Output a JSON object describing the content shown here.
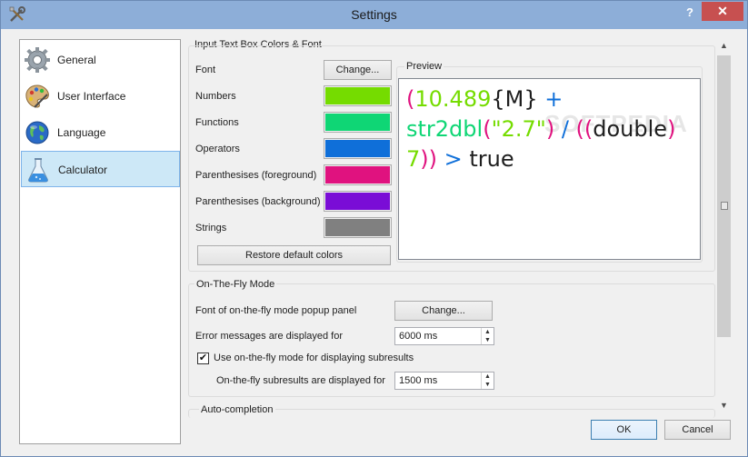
{
  "window": {
    "title": "Settings",
    "help": "?",
    "close": "✕"
  },
  "nav": {
    "items": [
      {
        "label": "General",
        "icon": "gear-icon"
      },
      {
        "label": "User Interface",
        "icon": "palette-icon"
      },
      {
        "label": "Language",
        "icon": "globe-icon"
      },
      {
        "label": "Calculator",
        "icon": "flask-icon",
        "selected": true
      }
    ]
  },
  "input_colors": {
    "title": "Input Text Box Colors & Font",
    "font_label": "Font",
    "font_button": "Change...",
    "rows": [
      {
        "label": "Numbers",
        "color": "#75dc00"
      },
      {
        "label": "Functions",
        "color": "#0fd675"
      },
      {
        "label": "Operators",
        "color": "#0f6fd9"
      },
      {
        "label": "Parenthesises (foreground)",
        "color": "#e0127f"
      },
      {
        "label": "Parenthesises (background)",
        "color": "#7a0dd6"
      },
      {
        "label": "Strings",
        "color": "#808080"
      }
    ],
    "restore_button": "Restore default colors",
    "preview_title": "Preview",
    "watermark": "SOFTPEDIA",
    "preview_tokens": [
      {
        "t": "(",
        "c": "#e0127f"
      },
      {
        "t": "10.489",
        "c": "#75dc00"
      },
      {
        "t": "{M}",
        "c": "#1e1e1e"
      },
      {
        "t": " + ",
        "c": "#0f6fd9"
      },
      {
        "t": "str2dbl",
        "c": "#0fd675"
      },
      {
        "t": "(",
        "c": "#e0127f"
      },
      {
        "t": "\"2.7\"",
        "c": "#75dc00"
      },
      {
        "t": ")",
        "c": "#e0127f"
      },
      {
        "t": " / ",
        "c": "#0f6fd9"
      },
      {
        "t": "((",
        "c": "#e0127f"
      },
      {
        "t": "double",
        "c": "#1e1e1e"
      },
      {
        "t": " 7",
        "c": "#75dc00"
      },
      {
        "t": "))",
        "c": "#e0127f"
      },
      {
        "t": " > ",
        "c": "#0f6fd9"
      },
      {
        "t": "true",
        "c": "#1e1e1e"
      }
    ]
  },
  "on_the_fly": {
    "title": "On-The-Fly Mode",
    "font_label": "Font of on-the-fly mode popup panel",
    "font_button": "Change...",
    "error_label": "Error messages are displayed for",
    "error_value": "6000 ms",
    "use_label": "Use on-the-fly mode for displaying subresults",
    "use_checked": "✔",
    "subresults_label": "On-the-fly subresults are displayed for",
    "subresults_value": "1500 ms"
  },
  "auto_completion": {
    "title": "Auto-completion"
  },
  "footer": {
    "ok": "OK",
    "cancel": "Cancel"
  }
}
